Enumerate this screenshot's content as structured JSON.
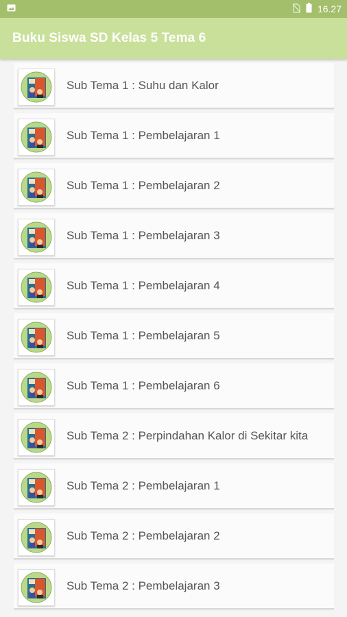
{
  "status_bar": {
    "left_icon": "image-icon",
    "icons": [
      "no-sim-icon",
      "battery-icon"
    ],
    "time": "16.27"
  },
  "app_bar": {
    "title": "Buku Siswa SD Kelas 5 Tema 6"
  },
  "list": {
    "items": [
      {
        "label": "Sub Tema 1 : Suhu dan Kalor"
      },
      {
        "label": "Sub Tema 1 : Pembelajaran 1"
      },
      {
        "label": "Sub Tema 1 : Pembelajaran 2"
      },
      {
        "label": "Sub Tema 1 : Pembelajaran 3"
      },
      {
        "label": "Sub Tema 1 : Pembelajaran 4"
      },
      {
        "label": "Sub Tema 1 : Pembelajaran 5"
      },
      {
        "label": "Sub Tema 1 : Pembelajaran 6"
      },
      {
        "label": "Sub Tema 2 : Perpindahan Kalor di Sekitar kita"
      },
      {
        "label": "Sub Tema 2 : Pembelajaran 1"
      },
      {
        "label": "Sub Tema 2 : Pembelajaran 2"
      },
      {
        "label": "Sub Tema 2 : Pembelajaran 3"
      }
    ]
  },
  "colors": {
    "status_bar": "#a3bf6c",
    "app_bar": "#c9e09a",
    "thumb_circle": "#b9d98a"
  }
}
